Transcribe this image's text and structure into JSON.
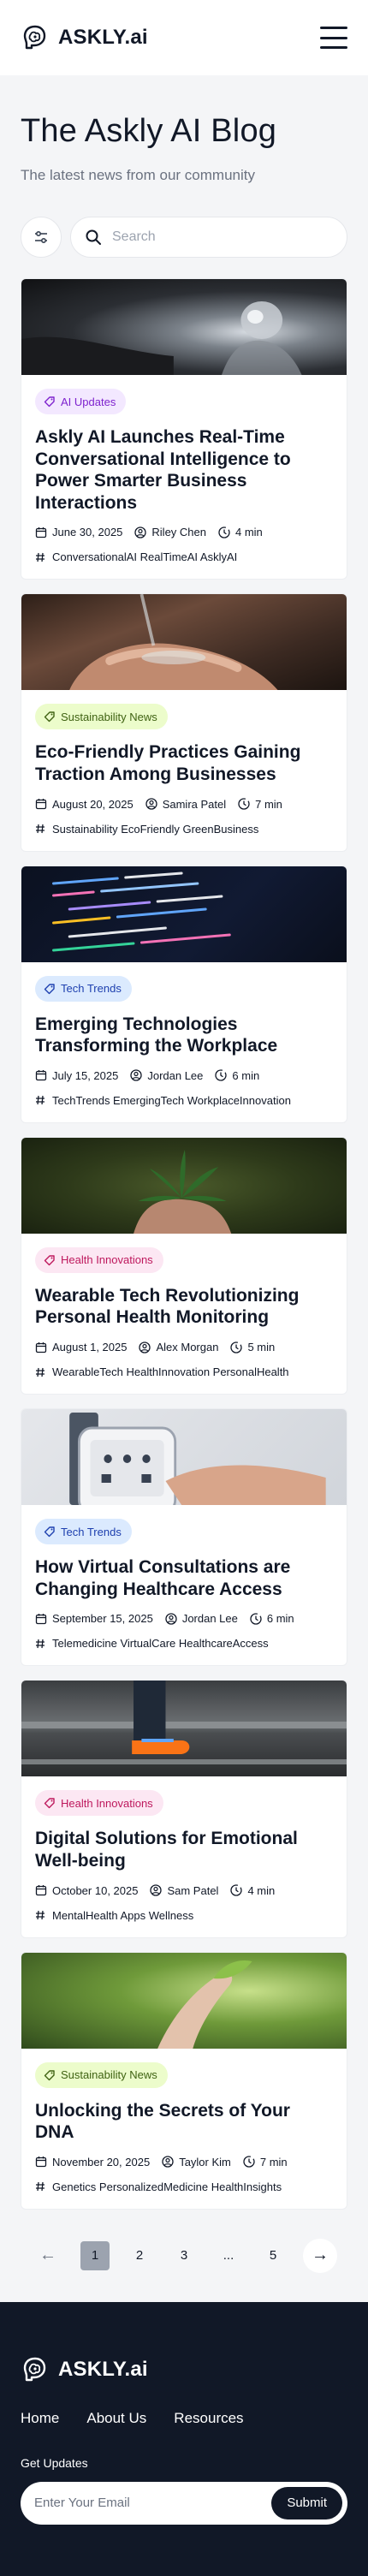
{
  "brand": {
    "name": "ASKLY.ai",
    "logo_icon": "brain-logo-icon"
  },
  "header": {
    "menu_icon": "hamburger-menu-icon"
  },
  "hero": {
    "title": "The Askly AI Blog",
    "subtitle": "The latest news from our community"
  },
  "search": {
    "placeholder": "Search",
    "filter_icon": "filter-sliders-icon",
    "search_icon": "search-icon"
  },
  "colors": {
    "dark": "#111827",
    "purple_badge": "#f3e8ff",
    "green_badge": "#ecfccb",
    "blue_badge": "#dbeafe",
    "pink_badge": "#fce7f3"
  },
  "posts": [
    {
      "category": "AI Updates",
      "title": "Askly AI Launches Real-Time Conversational Intelligence to Power Smarter Business Interactions",
      "date": "June 30, 2025",
      "author": "Riley Chen",
      "read_time": "4 min",
      "tags": "ConversationalAI RealTimeAI AsklyAI"
    },
    {
      "category": "Sustainability News",
      "title": "Eco-Friendly Practices Gaining Traction Among Businesses",
      "date": "August 20, 2025",
      "author": "Samira Patel",
      "read_time": "7 min",
      "tags": "Sustainability EcoFriendly GreenBusiness"
    },
    {
      "category": "Tech Trends",
      "title": "Emerging Technologies Transforming the Workplace",
      "date": "July 15, 2025",
      "author": "Jordan Lee",
      "read_time": "6 min",
      "tags": "TechTrends EmergingTech WorkplaceInnovation"
    },
    {
      "category": "Health Innovations",
      "title": "Wearable Tech Revolutionizing Personal Health Monitoring",
      "date": "August 1, 2025",
      "author": "Alex Morgan",
      "read_time": "5 min",
      "tags": "WearableTech HealthInnovation PersonalHealth"
    },
    {
      "category": "Tech Trends",
      "title": "How Virtual Consultations are Changing Healthcare Access",
      "date": "September 15, 2025",
      "author": "Jordan Lee",
      "read_time": "6 min",
      "tags": "Telemedicine VirtualCare HealthcareAccess"
    },
    {
      "category": "Health Innovations",
      "title": "Digital Solutions for Emotional Well-being",
      "date": "October 10, 2025",
      "author": "Sam Patel",
      "read_time": "4 min",
      "tags": "MentalHealth Apps Wellness"
    },
    {
      "category": "Sustainability News",
      "title": "Unlocking the Secrets of Your DNA",
      "date": "November 20, 2025",
      "author": "Taylor Kim",
      "read_time": "7 min",
      "tags": "Genetics PersonalizedMedicine HealthInsights"
    }
  ],
  "pagination": {
    "prev": "←",
    "pages": [
      "1",
      "2",
      "3",
      "...",
      "5"
    ],
    "current": "1",
    "next": "→"
  },
  "footer": {
    "links": [
      "Home",
      "About Us",
      "Resources"
    ],
    "updates_label": "Get Updates",
    "email_placeholder": "Enter Your Email",
    "submit_label": "Submit"
  }
}
